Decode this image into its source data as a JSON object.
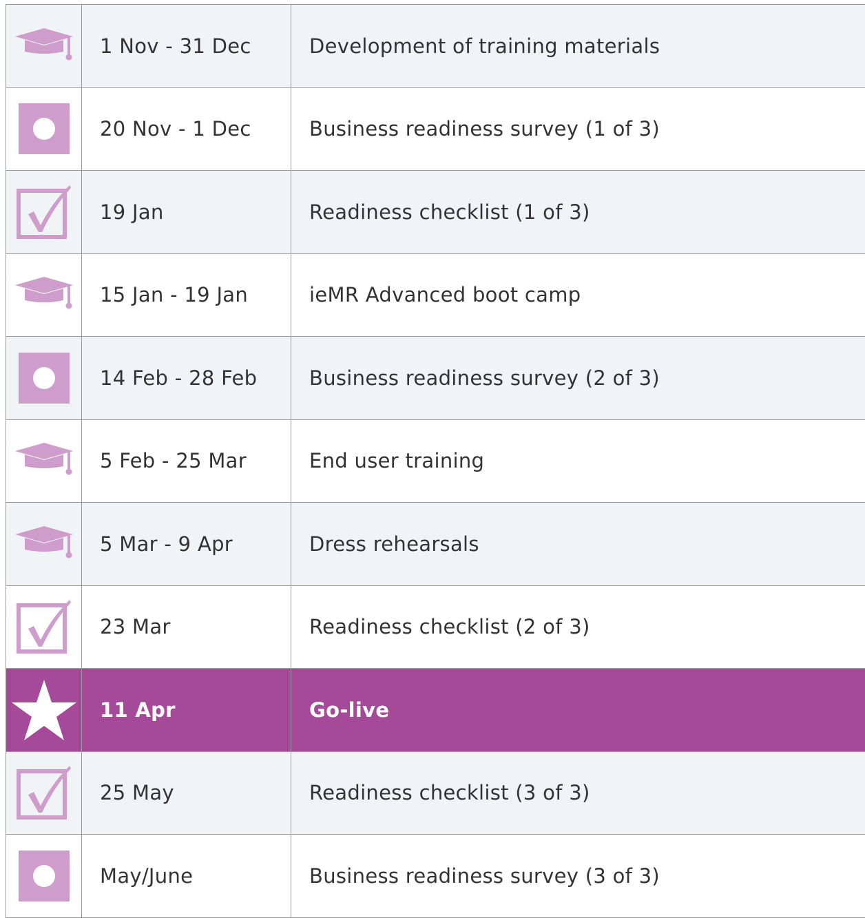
{
  "colors": {
    "accent": "#a44a98",
    "icon": "#cf9dcc",
    "row_shade": "#f1f4f7",
    "text": "#333333",
    "border": "#9a9a9a"
  },
  "rows": [
    {
      "icon": "graduation-cap-icon",
      "date": "1 Nov - 31 Dec",
      "task": "Development of training materials"
    },
    {
      "icon": "survey-icon",
      "date": "20 Nov - 1 Dec",
      "task": "Business readiness survey (1 of 3)"
    },
    {
      "icon": "checkbox-icon",
      "date": "19 Jan",
      "task": "Readiness checklist (1 of 3)"
    },
    {
      "icon": "graduation-cap-icon",
      "date": "15 Jan - 19 Jan",
      "task": "ieMR Advanced boot camp"
    },
    {
      "icon": "survey-icon",
      "date": "14 Feb - 28 Feb",
      "task": "Business readiness survey (2 of 3)"
    },
    {
      "icon": "graduation-cap-icon",
      "date": "5 Feb - 25 Mar",
      "task": "End user training"
    },
    {
      "icon": "graduation-cap-icon",
      "date": "5 Mar - 9 Apr",
      "task": "Dress rehearsals"
    },
    {
      "icon": "checkbox-icon",
      "date": "23 Mar",
      "task": "Readiness checklist (2 of 3)"
    },
    {
      "icon": "star-icon",
      "date": "11 Apr",
      "task": "Go-live"
    },
    {
      "icon": "checkbox-icon",
      "date": "25 May",
      "task": "Readiness checklist (3 of 3)"
    },
    {
      "icon": "survey-icon",
      "date": "May/June",
      "task": "Business readiness survey (3 of 3)"
    }
  ]
}
